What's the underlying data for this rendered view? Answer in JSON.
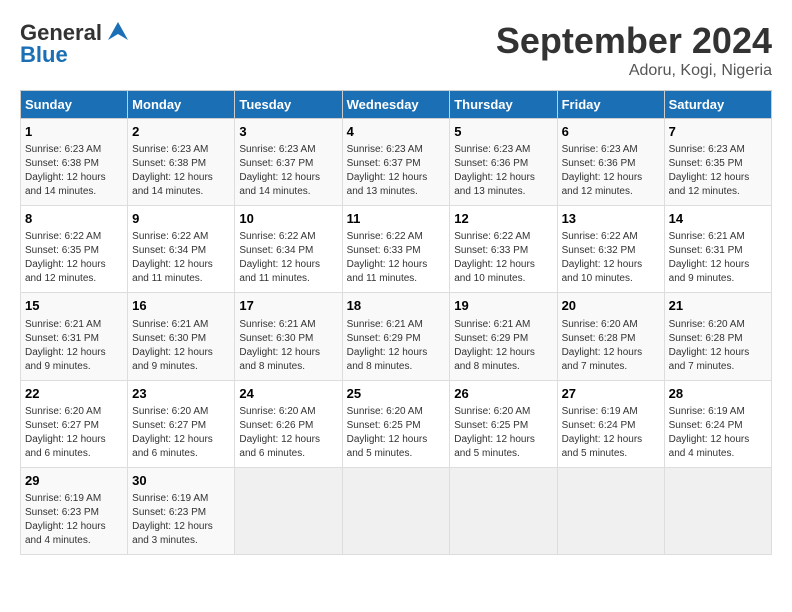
{
  "header": {
    "logo_line1": "General",
    "logo_line2": "Blue",
    "month": "September 2024",
    "location": "Adoru, Kogi, Nigeria"
  },
  "days_of_week": [
    "Sunday",
    "Monday",
    "Tuesday",
    "Wednesday",
    "Thursday",
    "Friday",
    "Saturday"
  ],
  "weeks": [
    [
      {
        "day": "1",
        "info": "Sunrise: 6:23 AM\nSunset: 6:38 PM\nDaylight: 12 hours\nand 14 minutes."
      },
      {
        "day": "2",
        "info": "Sunrise: 6:23 AM\nSunset: 6:38 PM\nDaylight: 12 hours\nand 14 minutes."
      },
      {
        "day": "3",
        "info": "Sunrise: 6:23 AM\nSunset: 6:37 PM\nDaylight: 12 hours\nand 14 minutes."
      },
      {
        "day": "4",
        "info": "Sunrise: 6:23 AM\nSunset: 6:37 PM\nDaylight: 12 hours\nand 13 minutes."
      },
      {
        "day": "5",
        "info": "Sunrise: 6:23 AM\nSunset: 6:36 PM\nDaylight: 12 hours\nand 13 minutes."
      },
      {
        "day": "6",
        "info": "Sunrise: 6:23 AM\nSunset: 6:36 PM\nDaylight: 12 hours\nand 12 minutes."
      },
      {
        "day": "7",
        "info": "Sunrise: 6:23 AM\nSunset: 6:35 PM\nDaylight: 12 hours\nand 12 minutes."
      }
    ],
    [
      {
        "day": "8",
        "info": "Sunrise: 6:22 AM\nSunset: 6:35 PM\nDaylight: 12 hours\nand 12 minutes."
      },
      {
        "day": "9",
        "info": "Sunrise: 6:22 AM\nSunset: 6:34 PM\nDaylight: 12 hours\nand 11 minutes."
      },
      {
        "day": "10",
        "info": "Sunrise: 6:22 AM\nSunset: 6:34 PM\nDaylight: 12 hours\nand 11 minutes."
      },
      {
        "day": "11",
        "info": "Sunrise: 6:22 AM\nSunset: 6:33 PM\nDaylight: 12 hours\nand 11 minutes."
      },
      {
        "day": "12",
        "info": "Sunrise: 6:22 AM\nSunset: 6:33 PM\nDaylight: 12 hours\nand 10 minutes."
      },
      {
        "day": "13",
        "info": "Sunrise: 6:22 AM\nSunset: 6:32 PM\nDaylight: 12 hours\nand 10 minutes."
      },
      {
        "day": "14",
        "info": "Sunrise: 6:21 AM\nSunset: 6:31 PM\nDaylight: 12 hours\nand 9 minutes."
      }
    ],
    [
      {
        "day": "15",
        "info": "Sunrise: 6:21 AM\nSunset: 6:31 PM\nDaylight: 12 hours\nand 9 minutes."
      },
      {
        "day": "16",
        "info": "Sunrise: 6:21 AM\nSunset: 6:30 PM\nDaylight: 12 hours\nand 9 minutes."
      },
      {
        "day": "17",
        "info": "Sunrise: 6:21 AM\nSunset: 6:30 PM\nDaylight: 12 hours\nand 8 minutes."
      },
      {
        "day": "18",
        "info": "Sunrise: 6:21 AM\nSunset: 6:29 PM\nDaylight: 12 hours\nand 8 minutes."
      },
      {
        "day": "19",
        "info": "Sunrise: 6:21 AM\nSunset: 6:29 PM\nDaylight: 12 hours\nand 8 minutes."
      },
      {
        "day": "20",
        "info": "Sunrise: 6:20 AM\nSunset: 6:28 PM\nDaylight: 12 hours\nand 7 minutes."
      },
      {
        "day": "21",
        "info": "Sunrise: 6:20 AM\nSunset: 6:28 PM\nDaylight: 12 hours\nand 7 minutes."
      }
    ],
    [
      {
        "day": "22",
        "info": "Sunrise: 6:20 AM\nSunset: 6:27 PM\nDaylight: 12 hours\nand 6 minutes."
      },
      {
        "day": "23",
        "info": "Sunrise: 6:20 AM\nSunset: 6:27 PM\nDaylight: 12 hours\nand 6 minutes."
      },
      {
        "day": "24",
        "info": "Sunrise: 6:20 AM\nSunset: 6:26 PM\nDaylight: 12 hours\nand 6 minutes."
      },
      {
        "day": "25",
        "info": "Sunrise: 6:20 AM\nSunset: 6:25 PM\nDaylight: 12 hours\nand 5 minutes."
      },
      {
        "day": "26",
        "info": "Sunrise: 6:20 AM\nSunset: 6:25 PM\nDaylight: 12 hours\nand 5 minutes."
      },
      {
        "day": "27",
        "info": "Sunrise: 6:19 AM\nSunset: 6:24 PM\nDaylight: 12 hours\nand 5 minutes."
      },
      {
        "day": "28",
        "info": "Sunrise: 6:19 AM\nSunset: 6:24 PM\nDaylight: 12 hours\nand 4 minutes."
      }
    ],
    [
      {
        "day": "29",
        "info": "Sunrise: 6:19 AM\nSunset: 6:23 PM\nDaylight: 12 hours\nand 4 minutes."
      },
      {
        "day": "30",
        "info": "Sunrise: 6:19 AM\nSunset: 6:23 PM\nDaylight: 12 hours\nand 3 minutes."
      },
      {
        "day": "",
        "info": ""
      },
      {
        "day": "",
        "info": ""
      },
      {
        "day": "",
        "info": ""
      },
      {
        "day": "",
        "info": ""
      },
      {
        "day": "",
        "info": ""
      }
    ]
  ]
}
